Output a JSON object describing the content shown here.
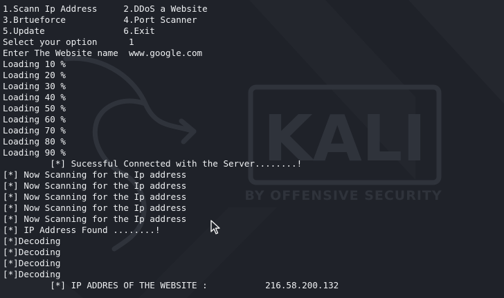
{
  "terminal": {
    "lines": [
      "1.Scann Ip Address     2.DDoS a Website",
      "3.Brtueforce           4.Port Scanner",
      "5.Update               6.Exit",
      "Select your option      1",
      "Enter The Website name  www.google.com",
      "Loading 10 %",
      "Loading 20 %",
      "Loading 30 %",
      "Loading 40 %",
      "Loading 50 %",
      "Loading 60 %",
      "Loading 70 %",
      "Loading 80 %",
      "Loading 90 %",
      "         [*] Sucessful Connected with the Server........!",
      "[*] Now Scanning for the Ip address",
      "[*] Now Scanning for the Ip address",
      "[*] Now Scanning for the Ip address",
      "[*] Now Scanning for the Ip address",
      "[*] Now Scanning for the Ip address",
      "[*] IP Address Found ........!",
      "[*]Decoding",
      "[*]Decoding",
      "[*]Decoding",
      "[*]Decoding",
      "         [*] IP ADDRES OF THE WEBSITE :           216.58.200.132"
    ]
  },
  "watermark": {
    "logo_text": "KALI",
    "tagline": "BY OFFENSIVE SECURITY"
  },
  "colors": {
    "background": "#1f2229",
    "text": "#eef0f2",
    "watermark": "#2f333b"
  },
  "icons": {
    "cursor": "mouse-pointer-icon",
    "dragon": "kali-dragon-icon"
  }
}
